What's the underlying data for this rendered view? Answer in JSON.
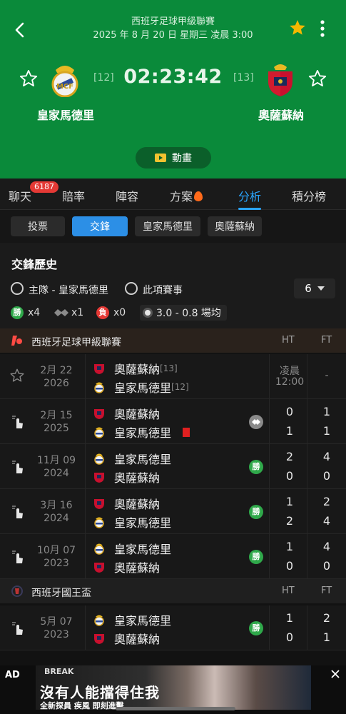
{
  "header": {
    "league_title": "西班牙足球甲級聯賽",
    "datetime": "2025 年 8 月 20 日 星期三 凌晨 3:00",
    "countdown": "02:23:42",
    "animation_label": "動畫"
  },
  "home": {
    "name": "皇家馬德里",
    "rank": "[12]"
  },
  "away": {
    "name": "奧薩蘇納",
    "rank": "[13]"
  },
  "tabs": [
    {
      "label": "聊天",
      "badge": "6187"
    },
    {
      "label": "賠率"
    },
    {
      "label": "陣容"
    },
    {
      "label": "方案"
    },
    {
      "label": "分析"
    },
    {
      "label": "積分榜"
    }
  ],
  "subtabs": [
    "投票",
    "交鋒",
    "皇家馬德里",
    "奧薩蘇納"
  ],
  "h2h": {
    "title": "交鋒歷史",
    "filter_home": "主隊 - 皇家馬德里",
    "filter_comp": "此項賽事",
    "count": "6",
    "win_label": "勝",
    "win_count": "x4",
    "draw_count": "x1",
    "loss_label": "負",
    "loss_count": "x0",
    "goals": "3.0 - 0.8 場均"
  },
  "leagues": [
    {
      "name": "西班牙足球甲級聯賽",
      "ht": "HT",
      "ft": "FT"
    },
    {
      "name": "西班牙國王盃",
      "ht": "HT",
      "ft": "FT"
    }
  ],
  "matches": [
    {
      "date": "2月 22",
      "year": "2026",
      "top": "奧薩蘇納",
      "top_rank": "[13]",
      "bottom": "皇家馬德里",
      "bottom_rank": "[12]",
      "ht_top": "凌晨",
      "ht_bottom": "12:00",
      "ft_top": "-",
      "ft_bottom": ""
    },
    {
      "date": "2月 15",
      "year": "2025",
      "top": "奧薩蘇納",
      "bottom": "皇家馬德里",
      "ht_top": "0",
      "ht_bottom": "1",
      "ft_top": "1",
      "ft_bottom": "1"
    },
    {
      "date": "11月 09",
      "year": "2024",
      "top": "皇家馬德里",
      "bottom": "奧薩蘇納",
      "ht_top": "2",
      "ht_bottom": "0",
      "ft_top": "4",
      "ft_bottom": "0",
      "result": "勝"
    },
    {
      "date": "3月 16",
      "year": "2024",
      "top": "奧薩蘇納",
      "bottom": "皇家馬德里",
      "ht_top": "1",
      "ht_bottom": "2",
      "ft_top": "2",
      "ft_bottom": "4",
      "result": "勝"
    },
    {
      "date": "10月 07",
      "year": "2023",
      "top": "皇家馬德里",
      "bottom": "奧薩蘇納",
      "ht_top": "1",
      "ht_bottom": "0",
      "ft_top": "4",
      "ft_bottom": "0",
      "result": "勝"
    },
    {
      "date": "5月 07",
      "year": "2023",
      "top": "皇家馬德里",
      "bottom": "奧薩蘇納",
      "ht_top": "1",
      "ht_bottom": "0",
      "ft_top": "2",
      "ft_bottom": "1",
      "result": "勝"
    }
  ],
  "ad": {
    "label": "AD",
    "brand": "BREAK",
    "headline": "沒有人能擋得住我",
    "subline": "全新探員 疾風 即刻進擊"
  },
  "colors": {
    "hero_green": "#0a8a3a",
    "accent_blue": "#2aa5ff",
    "win_green": "#2fa84a",
    "loss_red": "#e53935",
    "star_gold": "#f5b800"
  }
}
